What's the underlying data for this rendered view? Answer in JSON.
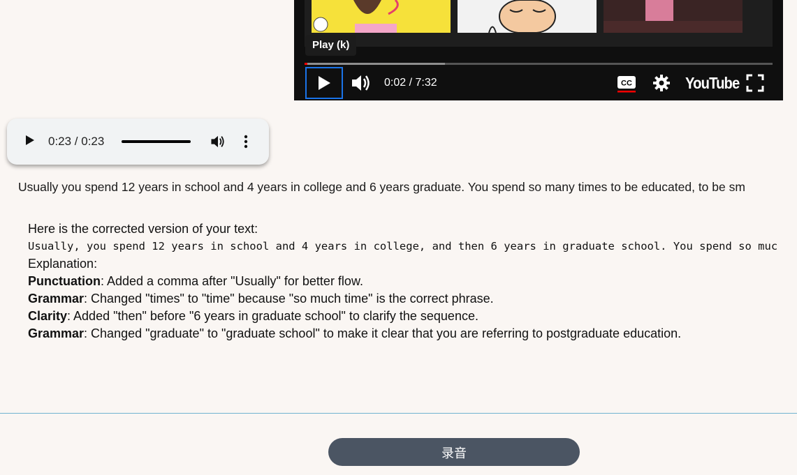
{
  "video": {
    "tooltip": "Play (k)",
    "time": "0:02 / 7:32",
    "logo": "YouTube",
    "progress_fraction": 0.006,
    "loaded_fraction": 0.3
  },
  "audio": {
    "time": "0:23 / 0:23"
  },
  "transcript": "Usually you spend 12 years in school and 4 years in college and 6 years graduate. You spend so many times to be educated, to be sm",
  "correction": {
    "intro": "Here is the corrected version of your text:",
    "corrected_text": "Usually, you spend 12 years in school and 4 years in college, and then 6 years in graduate school. You spend so muc",
    "explanation_label": "Explanation:",
    "items": [
      {
        "term": "Punctuation",
        "text": ": Added a comma after \"Usually\" for better flow."
      },
      {
        "term": "Grammar",
        "text": ": Changed \"times\" to \"time\" because \"so much time\" is the correct phrase."
      },
      {
        "term": "Clarity",
        "text": ": Added \"then\" before \"6 years in graduate school\" to clarify the sequence."
      },
      {
        "term": "Grammar",
        "text": ": Changed \"graduate\" to \"graduate school\" to make it clear that you are referring to postgraduate education."
      }
    ]
  },
  "record_button": "录音",
  "colors": {
    "accent_line": "#6fb3d0",
    "button_bg": "#4b5563",
    "page_bg": "#faf6f3"
  }
}
